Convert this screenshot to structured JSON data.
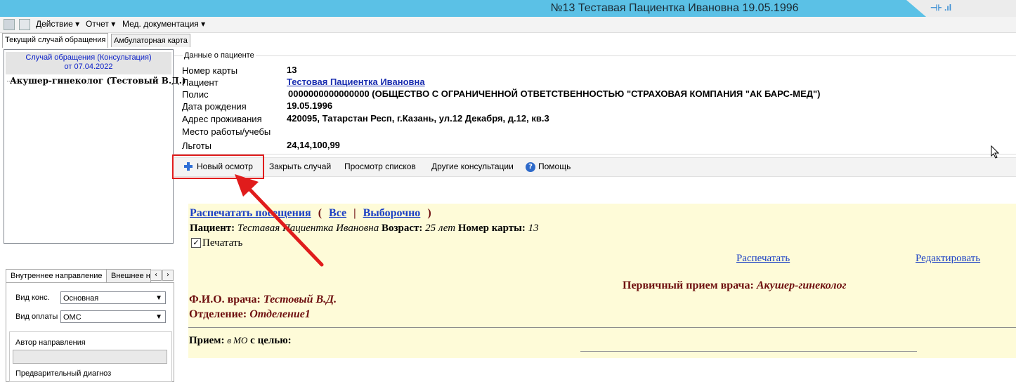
{
  "window": {
    "title": "№13 Теставая Пациентка Ивановна 19.05.1996",
    "signal_label": "⊣⊦ .ıl"
  },
  "menu": {
    "items": [
      "Действие ▾",
      "Отчет ▾",
      "Мед. документация ▾"
    ]
  },
  "tabs": {
    "current": "Текущий случай обращения",
    "outpatient": "Амбулаторная карта"
  },
  "case": {
    "header_line1": "Случай обращения (Консультация)",
    "header_line2": "от 07.04.2022",
    "doctor_item": "Акушер-гинеколог (Тестовый В.Д.)"
  },
  "direction": {
    "tab_internal": "Внутреннее направление",
    "tab_external": "Внешнее на",
    "nav_prev": "‹",
    "nav_next": "›",
    "consult_type_label": "Вид конс.",
    "consult_type_value": "Основная",
    "payment_type_label": "Вид оплаты",
    "payment_type_value": "ОМС",
    "author_label": "Автор направления",
    "prelim_diag_label": "Предварительный диагноз"
  },
  "patient": {
    "group_label": "Данные о пациенте",
    "card_label": "Номер карты",
    "card_value": "13",
    "name_label": "Пациент",
    "name_value": "Тестовая Пациентка Ивановна",
    "policy_label": "Полис",
    "policy_value": "0000000000000000 (ОБЩЕСТВО С ОГРАНИЧЕННОЙ ОТВЕТСТВЕННОСТЬЮ \"СТРАХОВАЯ КОМПАНИЯ \"АК БАРС-МЕД\")",
    "birth_label": "Дата рождения",
    "birth_value": "19.05.1996",
    "address_label": "Адрес проживания",
    "address_value": "420095, Татарстан Респ, г.Казань, ул.12 Декабря, д.12, кв.3",
    "work_label": "Место работы/учебы",
    "benefits_label": "Льготы",
    "benefits_value": "24,14,100,99"
  },
  "toolbar": {
    "new_exam": "Новый осмотр",
    "close_case": "Закрыть случай",
    "view_lists": "Просмотр списков",
    "other_consults": "Другие консультации",
    "help": "Помощь"
  },
  "document": {
    "print_visits": "Распечатать посещения",
    "paren_open": "(",
    "all": "Все",
    "sep": "|",
    "selective": "Выборочно",
    "paren_close": ")",
    "patient_label": "Пациент:",
    "patient_name": "Теставая Пациентка Ивановна",
    "age_label": "Возраст:",
    "age_value": "25 лет",
    "card_label": "Номер карты:",
    "card_value": "13",
    "print_checkbox": "Печатать",
    "print_link": "Распечатать",
    "edit_link": "Редактировать",
    "visit_title_label": "Первичный прием врача:",
    "visit_title_value": "Акушер-гинеколог",
    "doctor_label": "Ф.И.О. врача:",
    "doctor_value": "Тестовый В.Д.",
    "dept_label": "Отделение:",
    "dept_value": "Отделение1",
    "reception_label": "Прием:",
    "reception_place": "в МО",
    "reception_purpose": "с целью:"
  },
  "colors": {
    "titlebar": "#5bc1e6",
    "annotation_red": "#e01c1c",
    "doc_background": "#fefbd8",
    "link_blue": "#1a3fc4",
    "maroon": "#6e0f0f"
  }
}
